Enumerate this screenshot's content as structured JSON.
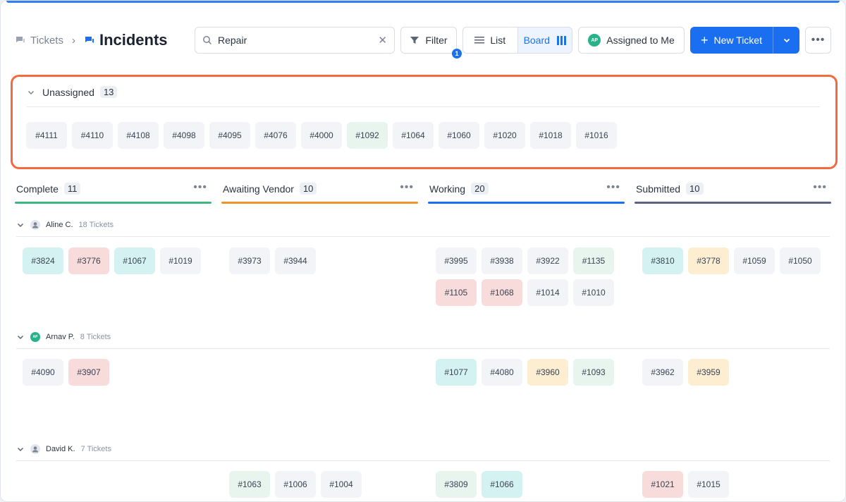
{
  "breadcrumb": {
    "parent": "Tickets",
    "current": "Incidents"
  },
  "search": {
    "value": "Repair",
    "clear_icon": "close-icon"
  },
  "toolbar": {
    "filter_label": "Filter",
    "filter_badge": "1",
    "view_list_label": "List",
    "view_board_label": "Board",
    "assigned_label": "Assigned to Me",
    "assigned_avatar": "AP",
    "new_ticket_label": "New Ticket"
  },
  "colors": {
    "accent": "#1a6ff0",
    "highlight_border": "#f26a3d",
    "complete": "#3db77f",
    "awaiting_vendor": "#f0932b",
    "working": "#1a6ff0",
    "submitted": "#5c6282"
  },
  "unassigned": {
    "label": "Unassigned",
    "count": "13",
    "tickets": [
      {
        "id": "#4111",
        "color": "gray"
      },
      {
        "id": "#4110",
        "color": "gray"
      },
      {
        "id": "#4108",
        "color": "gray"
      },
      {
        "id": "#4098",
        "color": "gray"
      },
      {
        "id": "#4095",
        "color": "gray"
      },
      {
        "id": "#4076",
        "color": "gray"
      },
      {
        "id": "#4000",
        "color": "gray"
      },
      {
        "id": "#1092",
        "color": "green"
      },
      {
        "id": "#1064",
        "color": "gray"
      },
      {
        "id": "#1060",
        "color": "gray"
      },
      {
        "id": "#1020",
        "color": "gray"
      },
      {
        "id": "#1018",
        "color": "gray"
      },
      {
        "id": "#1016",
        "color": "gray"
      }
    ]
  },
  "columns": [
    {
      "name": "Complete",
      "count": "11"
    },
    {
      "name": "Awaiting Vendor",
      "count": "10"
    },
    {
      "name": "Working",
      "count": "20"
    },
    {
      "name": "Submitted",
      "count": "10"
    }
  ],
  "groups": [
    {
      "user": "Aline C.",
      "tickets_label": "18 Tickets",
      "avatar": "person-icon",
      "cells": [
        [
          {
            "id": "#3824",
            "color": "cyan"
          },
          {
            "id": "#3776",
            "color": "red"
          },
          {
            "id": "#1067",
            "color": "cyan"
          },
          {
            "id": "#1019",
            "color": "gray"
          }
        ],
        [
          {
            "id": "#3973",
            "color": "gray"
          },
          {
            "id": "#3944",
            "color": "gray"
          }
        ],
        [
          {
            "id": "#3995",
            "color": "gray"
          },
          {
            "id": "#3938",
            "color": "gray"
          },
          {
            "id": "#3922",
            "color": "gray"
          },
          {
            "id": "#1135",
            "color": "green"
          },
          {
            "id": "#1105",
            "color": "red"
          },
          {
            "id": "#1068",
            "color": "red"
          },
          {
            "id": "#1014",
            "color": "gray"
          },
          {
            "id": "#1010",
            "color": "gray"
          }
        ],
        [
          {
            "id": "#3810",
            "color": "cyan"
          },
          {
            "id": "#3778",
            "color": "yellow"
          },
          {
            "id": "#1059",
            "color": "gray"
          },
          {
            "id": "#1050",
            "color": "gray"
          }
        ]
      ]
    },
    {
      "user": "Arnav P.",
      "tickets_label": "8 Tickets",
      "avatar": "AP",
      "cells": [
        [
          {
            "id": "#4090",
            "color": "gray"
          },
          {
            "id": "#3907",
            "color": "red"
          }
        ],
        [],
        [
          {
            "id": "#1077",
            "color": "cyan"
          },
          {
            "id": "#4080",
            "color": "gray"
          },
          {
            "id": "#3960",
            "color": "yellow"
          },
          {
            "id": "#1093",
            "color": "green"
          }
        ],
        [
          {
            "id": "#3962",
            "color": "gray"
          },
          {
            "id": "#3959",
            "color": "yellow"
          }
        ]
      ]
    },
    {
      "user": "David K.",
      "tickets_label": "7 Tickets",
      "avatar": "person-icon",
      "cells": [
        [],
        [
          {
            "id": "#1063",
            "color": "green"
          },
          {
            "id": "#1006",
            "color": "gray"
          },
          {
            "id": "#1004",
            "color": "gray"
          }
        ],
        [
          {
            "id": "#3809",
            "color": "green"
          },
          {
            "id": "#1066",
            "color": "cyan"
          }
        ],
        [
          {
            "id": "#1021",
            "color": "red"
          },
          {
            "id": "#1015",
            "color": "gray"
          }
        ]
      ]
    }
  ]
}
